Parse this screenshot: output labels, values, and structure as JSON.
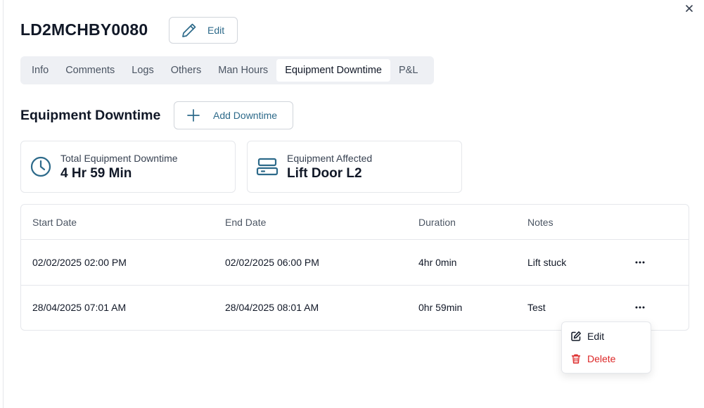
{
  "record_id": "LD2MCHBY0080",
  "header": {
    "edit_label": "Edit"
  },
  "tabs": [
    {
      "label": "Info"
    },
    {
      "label": "Comments"
    },
    {
      "label": "Logs"
    },
    {
      "label": "Others"
    },
    {
      "label": "Man Hours"
    },
    {
      "label": "Equipment Downtime",
      "active": true
    },
    {
      "label": "P&L"
    }
  ],
  "section": {
    "title": "Equipment Downtime",
    "add_label": "Add Downtime"
  },
  "summary": {
    "total": {
      "label": "Total Equipment Downtime",
      "value": "4 Hr 59 Min",
      "icon": "clock-icon"
    },
    "affected": {
      "label": "Equipment Affected",
      "value": "Lift Door L2",
      "icon": "equipment-icon"
    }
  },
  "table": {
    "columns": [
      "Start Date",
      "End Date",
      "Duration",
      "Notes"
    ],
    "rows": [
      {
        "start": "02/02/2025 02:00 PM",
        "end": "02/02/2025 06:00 PM",
        "duration": "4hr 0min",
        "notes": "Lift stuck"
      },
      {
        "start": "28/04/2025 07:01 AM",
        "end": "28/04/2025 08:01 AM",
        "duration": "0hr 59min",
        "notes": "Test"
      }
    ]
  },
  "context_menu": {
    "edit_label": "Edit",
    "delete_label": "Delete"
  },
  "colors": {
    "accent": "#2d6a8a",
    "danger": "#dc2626",
    "tab_bg": "#eef0f4"
  }
}
